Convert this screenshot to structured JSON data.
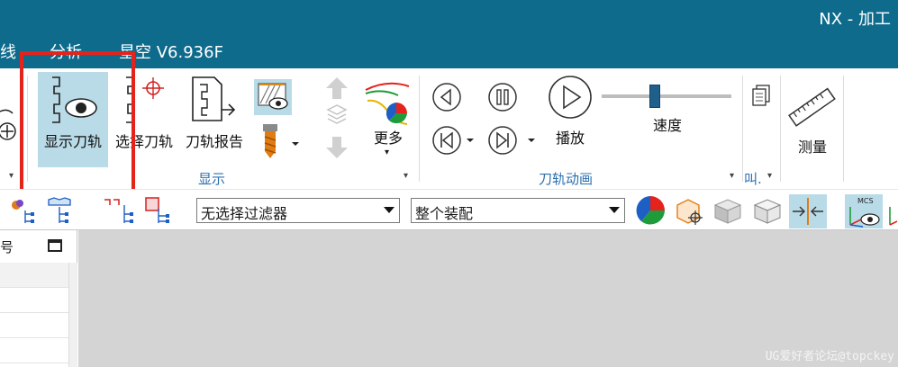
{
  "window": {
    "title": "NX - 加工"
  },
  "menu": {
    "items": [
      "线",
      "分析",
      "星空 V6.936F"
    ]
  },
  "ribbon": {
    "display_group": {
      "label": "显示",
      "tools": {
        "show_toolpath": "显示刀轨",
        "select_toolpath": "选择刀轨",
        "toolpath_report": "刀轨报告",
        "more": "更多"
      }
    },
    "animation_group": {
      "label": "刀轨动画",
      "play": "播放",
      "speed": "速度",
      "speed_level": 0.4
    },
    "partial_group_label": "叫.",
    "measure": "测量"
  },
  "toolbar2": {
    "filter_selected": "无选择过滤器",
    "scope_selected": "整个装配",
    "mcs_label": "MCS"
  },
  "navigator": {
    "header_partial": "号"
  },
  "watermark": "UG爱好者论坛@topckey",
  "colors": {
    "titlebar": "#0e6b8c",
    "highlight": "#b9dbe8",
    "callout": "#e4231c",
    "group_label": "#2b6fb0"
  }
}
